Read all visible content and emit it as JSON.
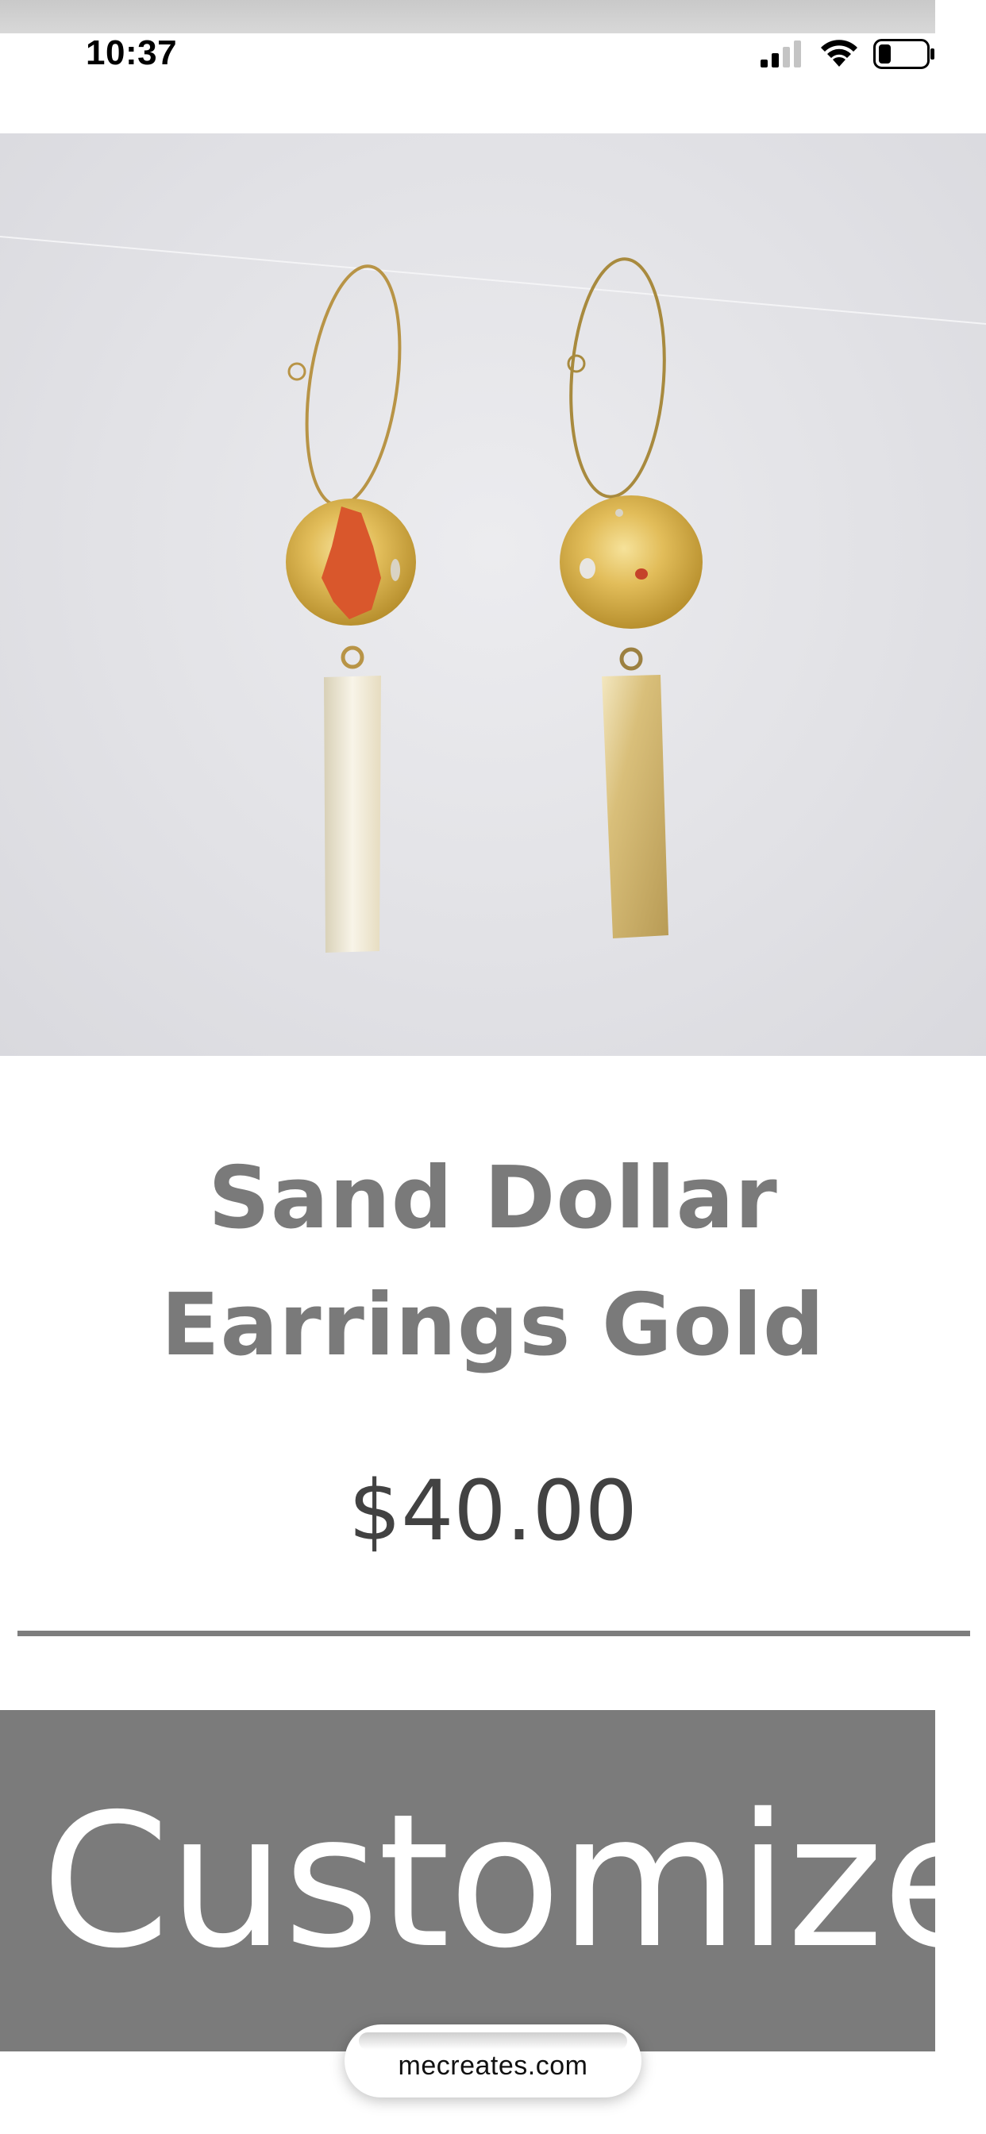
{
  "status_bar": {
    "time": "10:37",
    "icons": [
      "cellular-signal-icon",
      "wifi-icon",
      "battery-icon"
    ],
    "battery_level": 0.25
  },
  "product": {
    "image_alt": "product-photo-earrings",
    "title": "Sand Dollar Earrings Gold",
    "price": "$40.00"
  },
  "actions": {
    "customize_label": "Customize"
  },
  "browser": {
    "url": "mecreates.com"
  },
  "colors": {
    "title": "#7a7a7a",
    "price": "#424242",
    "divider": "#7d7d7d",
    "button_bg": "#7b7b7b",
    "button_text": "#ffffff"
  }
}
